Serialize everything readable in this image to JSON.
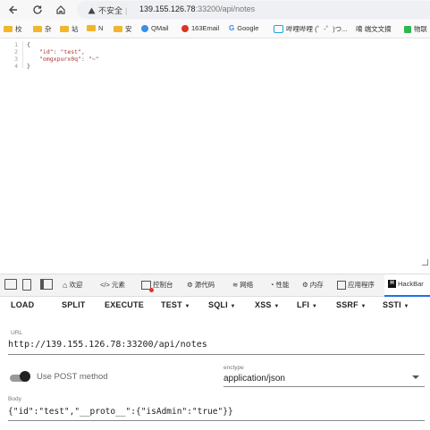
{
  "browser": {
    "address": {
      "security_label": "不安全",
      "host": "139.155.126.78",
      "path": ":33200/api/notes"
    },
    "bookmarks": [
      "校",
      "杂",
      "站",
      "N",
      "安",
      "QMail",
      "163Email",
      "Google",
      "哔哩哔哩 (゜-゜)つ...",
      "嘀 端文文摘",
      "物联"
    ]
  },
  "viewer": {
    "line_numbers": [
      "1",
      "2",
      "3",
      "4"
    ],
    "lines": {
      "l1": "{",
      "l2_key": "\"id\"",
      "l2_val": "\"test\"",
      "l3_key": "\"omgxpurx0q\"",
      "l3_val": "\"~\"",
      "l4": "}",
      "colon": ":",
      "comma": ","
    }
  },
  "devtools": {
    "tabs": [
      "欢迎",
      "元素",
      "控制台",
      "源代码",
      "网络",
      "性能",
      "内存",
      "应用程序",
      "HackBar"
    ]
  },
  "hackbar": {
    "menu": [
      "LOAD",
      "SPLIT",
      "EXECUTE",
      "TEST",
      "SQLI",
      "XSS",
      "LFI",
      "SSRF",
      "SSTI"
    ],
    "url_label": "URL",
    "url_value": "http://139.155.126.78:33200/api/notes",
    "post_label": "Use POST method",
    "enctype_label": "enctype",
    "enctype_value": "application/json",
    "body_label": "Body",
    "body_value": "{\"id\":\"test\",\"__proto__\":{\"isAdmin\":\"true\"}}"
  },
  "colors": {
    "accent": "#1a73e8",
    "json_string": "#aa3333",
    "folder": "#f2b62c"
  }
}
